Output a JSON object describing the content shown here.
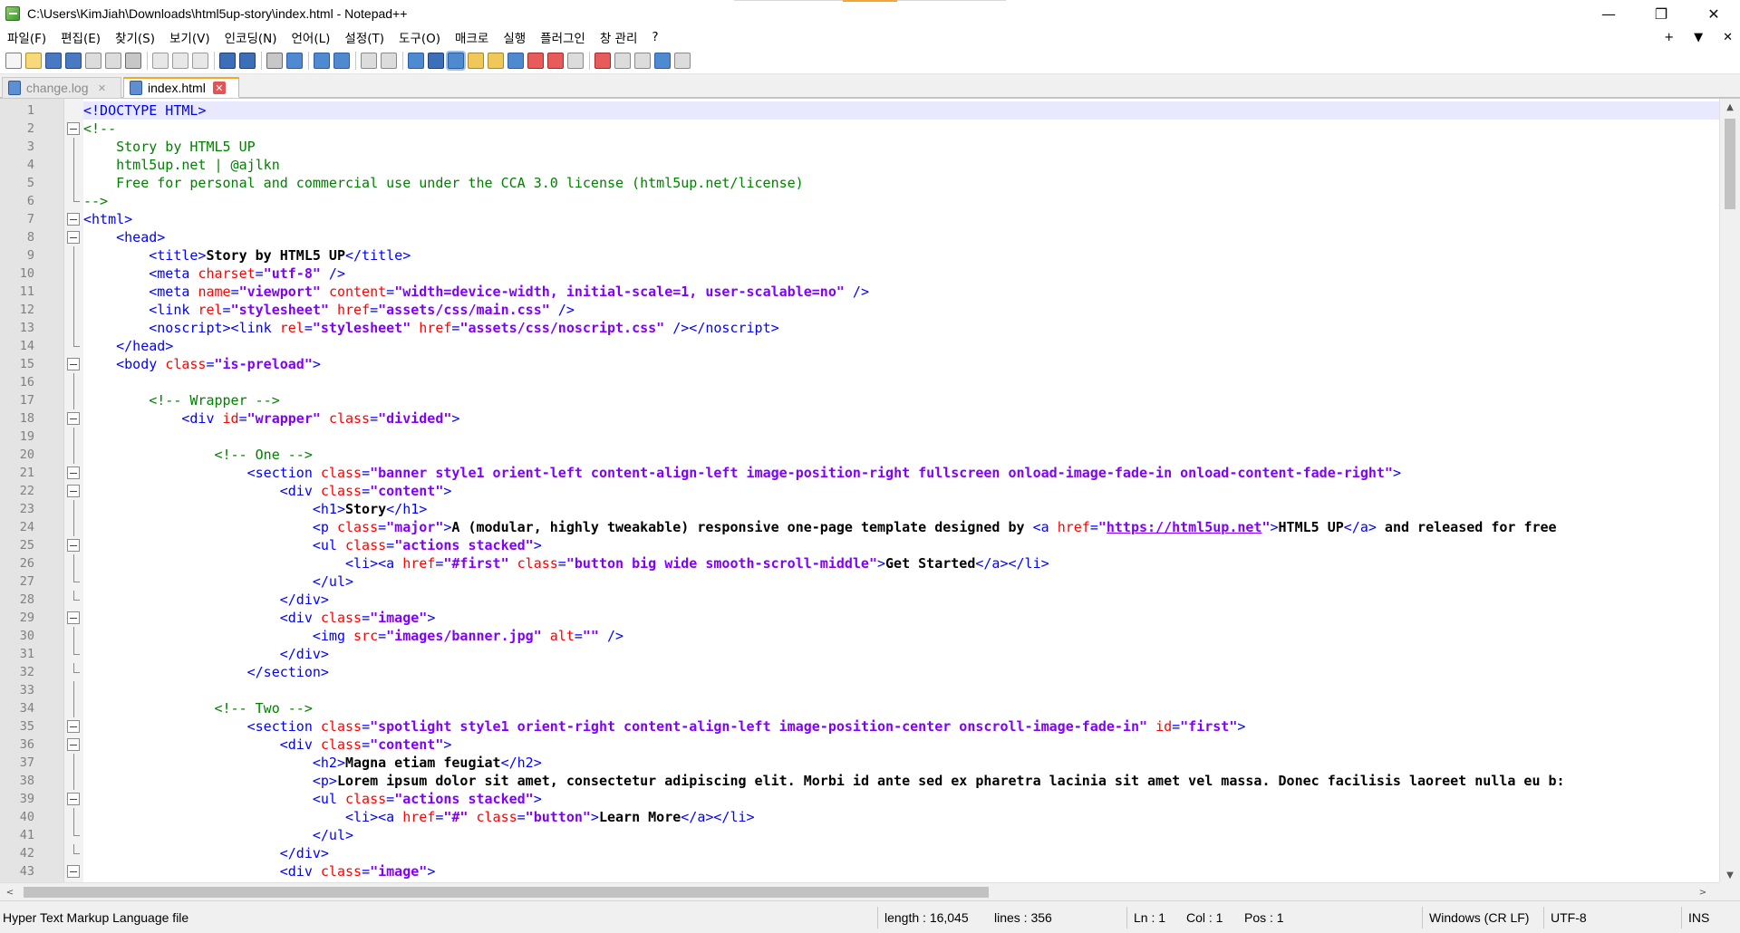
{
  "window": {
    "title": "C:\\Users\\KimJiah\\Downloads\\html5up-story\\index.html - Notepad++",
    "controls": [
      "—",
      "❐",
      "✕"
    ]
  },
  "menu": {
    "items": [
      "파일(F)",
      "편집(E)",
      "찾기(S)",
      "보기(V)",
      "인코딩(N)",
      "언어(L)",
      "설정(T)",
      "도구(O)",
      "매크로",
      "실행",
      "플러그인",
      "창 관리",
      "?"
    ],
    "right_controls": [
      "+",
      "▼",
      "✕"
    ]
  },
  "toolbar": {
    "buttons": [
      "new-file-icon",
      "open-file-icon",
      "save-icon",
      "save-all-icon",
      "close-icon",
      "close-all-icon",
      "print-icon",
      "cut-icon",
      "copy-icon",
      "paste-icon",
      "undo-icon",
      "redo-icon",
      "find-icon",
      "replace-icon",
      "zoom-in-icon",
      "zoom-out-icon",
      "sync-vertical-icon",
      "sync-horizontal-icon",
      "word-wrap-icon",
      "show-all-chars-icon",
      "indent-guide-icon",
      "udl-icon",
      "doc-map-icon",
      "function-list-icon",
      "folder-as-workspace-icon",
      "monitoring-icon",
      "record-macro-icon",
      "stop-macro-icon",
      "play-macro-icon",
      "run-macro-multiple-icon",
      "save-macro-icon"
    ],
    "active_button": "indent-guide-icon"
  },
  "tabs": [
    {
      "label": "change.log",
      "active": false
    },
    {
      "label": "index.html",
      "active": true
    }
  ],
  "editor": {
    "current_line": 1,
    "lines": [
      {
        "n": "1",
        "fold": "none",
        "tokens": [
          [
            "tag",
            "<!DOCTYPE HTML>"
          ]
        ]
      },
      {
        "n": "2",
        "fold": "box",
        "tokens": [
          [
            "com",
            "<!--"
          ]
        ]
      },
      {
        "n": "3",
        "fold": "vl",
        "tokens": [
          [
            "com",
            "\tStory by HTML5 UP"
          ]
        ]
      },
      {
        "n": "4",
        "fold": "vl",
        "tokens": [
          [
            "com",
            "\thtml5up.net | @ajlkn"
          ]
        ]
      },
      {
        "n": "5",
        "fold": "vl",
        "tokens": [
          [
            "com",
            "\tFree for personal and commercial use under the CCA 3.0 license (html5up.net/license)"
          ]
        ]
      },
      {
        "n": "6",
        "fold": "end",
        "tokens": [
          [
            "com",
            "-->"
          ]
        ]
      },
      {
        "n": "7",
        "fold": "box",
        "tokens": [
          [
            "tag",
            "<html>"
          ]
        ]
      },
      {
        "n": "8",
        "fold": "box",
        "tokens": [
          [
            "pl",
            "\t"
          ],
          [
            "tag",
            "<head>"
          ]
        ]
      },
      {
        "n": "9",
        "fold": "vl",
        "tokens": [
          [
            "pl",
            "\t\t"
          ],
          [
            "tag",
            "<title>"
          ],
          [
            "txt",
            "Story by HTML5 UP"
          ],
          [
            "tag",
            "</title>"
          ]
        ]
      },
      {
        "n": "10",
        "fold": "vl",
        "tokens": [
          [
            "pl",
            "\t\t"
          ],
          [
            "tag",
            "<meta "
          ],
          [
            "attr",
            "charset"
          ],
          [
            "tag",
            "="
          ],
          [
            "val",
            "\"utf-8\""
          ],
          [
            "tag",
            " />"
          ]
        ]
      },
      {
        "n": "11",
        "fold": "vl",
        "tokens": [
          [
            "pl",
            "\t\t"
          ],
          [
            "tag",
            "<meta "
          ],
          [
            "attr",
            "name"
          ],
          [
            "tag",
            "="
          ],
          [
            "val",
            "\"viewport\""
          ],
          [
            "tag",
            " "
          ],
          [
            "attr",
            "content"
          ],
          [
            "tag",
            "="
          ],
          [
            "val",
            "\"width=device-width, initial-scale=1, user-scalable=no\""
          ],
          [
            "tag",
            " />"
          ]
        ]
      },
      {
        "n": "12",
        "fold": "vl",
        "tokens": [
          [
            "pl",
            "\t\t"
          ],
          [
            "tag",
            "<link "
          ],
          [
            "attr",
            "rel"
          ],
          [
            "tag",
            "="
          ],
          [
            "val",
            "\"stylesheet\""
          ],
          [
            "tag",
            " "
          ],
          [
            "attr",
            "href"
          ],
          [
            "tag",
            "="
          ],
          [
            "val",
            "\"assets/css/main.css\""
          ],
          [
            "tag",
            " />"
          ]
        ]
      },
      {
        "n": "13",
        "fold": "vl",
        "tokens": [
          [
            "pl",
            "\t\t"
          ],
          [
            "tag",
            "<noscript><link "
          ],
          [
            "attr",
            "rel"
          ],
          [
            "tag",
            "="
          ],
          [
            "val",
            "\"stylesheet\""
          ],
          [
            "tag",
            " "
          ],
          [
            "attr",
            "href"
          ],
          [
            "tag",
            "="
          ],
          [
            "val",
            "\"assets/css/noscript.css\""
          ],
          [
            "tag",
            " /></noscript>"
          ]
        ]
      },
      {
        "n": "14",
        "fold": "end",
        "tokens": [
          [
            "pl",
            "\t"
          ],
          [
            "tag",
            "</head>"
          ]
        ]
      },
      {
        "n": "15",
        "fold": "box",
        "tokens": [
          [
            "pl",
            "\t"
          ],
          [
            "tag",
            "<body "
          ],
          [
            "attr",
            "class"
          ],
          [
            "tag",
            "="
          ],
          [
            "val",
            "\"is-preload\""
          ],
          [
            "tag",
            ">"
          ]
        ]
      },
      {
        "n": "16",
        "fold": "vl",
        "tokens": []
      },
      {
        "n": "17",
        "fold": "vl",
        "tokens": [
          [
            "pl",
            "\t\t"
          ],
          [
            "com",
            "<!-- Wrapper -->"
          ]
        ]
      },
      {
        "n": "18",
        "fold": "box",
        "tokens": [
          [
            "pl",
            "\t\t\t"
          ],
          [
            "tag",
            "<div "
          ],
          [
            "attr",
            "id"
          ],
          [
            "tag",
            "="
          ],
          [
            "val",
            "\"wrapper\""
          ],
          [
            "tag",
            " "
          ],
          [
            "attr",
            "class"
          ],
          [
            "tag",
            "="
          ],
          [
            "val",
            "\"divided\""
          ],
          [
            "tag",
            ">"
          ]
        ]
      },
      {
        "n": "19",
        "fold": "vl",
        "tokens": []
      },
      {
        "n": "20",
        "fold": "vl",
        "tokens": [
          [
            "pl",
            "\t\t\t\t"
          ],
          [
            "com",
            "<!-- One -->"
          ]
        ]
      },
      {
        "n": "21",
        "fold": "box",
        "tokens": [
          [
            "pl",
            "\t\t\t\t\t"
          ],
          [
            "tag",
            "<section "
          ],
          [
            "attr",
            "class"
          ],
          [
            "tag",
            "="
          ],
          [
            "val",
            "\"banner style1 orient-left content-align-left image-position-right fullscreen onload-image-fade-in onload-content-fade-right\""
          ],
          [
            "tag",
            ">"
          ]
        ]
      },
      {
        "n": "22",
        "fold": "box",
        "tokens": [
          [
            "pl",
            "\t\t\t\t\t\t"
          ],
          [
            "tag",
            "<div "
          ],
          [
            "attr",
            "class"
          ],
          [
            "tag",
            "="
          ],
          [
            "val",
            "\"content\""
          ],
          [
            "tag",
            ">"
          ]
        ]
      },
      {
        "n": "23",
        "fold": "vl",
        "tokens": [
          [
            "pl",
            "\t\t\t\t\t\t\t"
          ],
          [
            "tag",
            "<h1>"
          ],
          [
            "txt",
            "Story"
          ],
          [
            "tag",
            "</h1>"
          ]
        ]
      },
      {
        "n": "24",
        "fold": "vl",
        "tokens": [
          [
            "pl",
            "\t\t\t\t\t\t\t"
          ],
          [
            "tag",
            "<p "
          ],
          [
            "attr",
            "class"
          ],
          [
            "tag",
            "="
          ],
          [
            "val",
            "\"major\""
          ],
          [
            "tag",
            ">"
          ],
          [
            "txt",
            "A (modular, highly tweakable) responsive one-page template designed by "
          ],
          [
            "tag",
            "<a "
          ],
          [
            "attr",
            "href"
          ],
          [
            "tag",
            "="
          ],
          [
            "val",
            "\""
          ],
          [
            "link",
            "https://html5up.net"
          ],
          [
            "val",
            "\""
          ],
          [
            "tag",
            ">"
          ],
          [
            "txt",
            "HTML5 UP"
          ],
          [
            "tag",
            "</a>"
          ],
          [
            "txt",
            " and released for free"
          ]
        ]
      },
      {
        "n": "25",
        "fold": "box",
        "tokens": [
          [
            "pl",
            "\t\t\t\t\t\t\t"
          ],
          [
            "tag",
            "<ul "
          ],
          [
            "attr",
            "class"
          ],
          [
            "tag",
            "="
          ],
          [
            "val",
            "\"actions stacked\""
          ],
          [
            "tag",
            ">"
          ]
        ]
      },
      {
        "n": "26",
        "fold": "vl",
        "tokens": [
          [
            "pl",
            "\t\t\t\t\t\t\t\t"
          ],
          [
            "tag",
            "<li><a "
          ],
          [
            "attr",
            "href"
          ],
          [
            "tag",
            "="
          ],
          [
            "val",
            "\"#first\""
          ],
          [
            "tag",
            " "
          ],
          [
            "attr",
            "class"
          ],
          [
            "tag",
            "="
          ],
          [
            "val",
            "\"button big wide smooth-scroll-middle\""
          ],
          [
            "tag",
            ">"
          ],
          [
            "txt",
            "Get Started"
          ],
          [
            "tag",
            "</a></li>"
          ]
        ]
      },
      {
        "n": "27",
        "fold": "end",
        "tokens": [
          [
            "pl",
            "\t\t\t\t\t\t\t"
          ],
          [
            "tag",
            "</ul>"
          ]
        ]
      },
      {
        "n": "28",
        "fold": "end",
        "tokens": [
          [
            "pl",
            "\t\t\t\t\t\t"
          ],
          [
            "tag",
            "</div>"
          ]
        ]
      },
      {
        "n": "29",
        "fold": "box",
        "tokens": [
          [
            "pl",
            "\t\t\t\t\t\t"
          ],
          [
            "tag",
            "<div "
          ],
          [
            "attr",
            "class"
          ],
          [
            "tag",
            "="
          ],
          [
            "val",
            "\"image\""
          ],
          [
            "tag",
            ">"
          ]
        ]
      },
      {
        "n": "30",
        "fold": "vl",
        "tokens": [
          [
            "pl",
            "\t\t\t\t\t\t\t"
          ],
          [
            "tag",
            "<img "
          ],
          [
            "attr",
            "src"
          ],
          [
            "tag",
            "="
          ],
          [
            "val",
            "\"images/banner.jpg\""
          ],
          [
            "tag",
            " "
          ],
          [
            "attr",
            "alt"
          ],
          [
            "tag",
            "="
          ],
          [
            "val",
            "\"\""
          ],
          [
            "tag",
            " />"
          ]
        ]
      },
      {
        "n": "31",
        "fold": "end",
        "tokens": [
          [
            "pl",
            "\t\t\t\t\t\t"
          ],
          [
            "tag",
            "</div>"
          ]
        ]
      },
      {
        "n": "32",
        "fold": "end",
        "tokens": [
          [
            "pl",
            "\t\t\t\t\t"
          ],
          [
            "tag",
            "</section>"
          ]
        ]
      },
      {
        "n": "33",
        "fold": "vl",
        "tokens": []
      },
      {
        "n": "34",
        "fold": "vl",
        "tokens": [
          [
            "pl",
            "\t\t\t\t"
          ],
          [
            "com",
            "<!-- Two -->"
          ]
        ]
      },
      {
        "n": "35",
        "fold": "box",
        "tokens": [
          [
            "pl",
            "\t\t\t\t\t"
          ],
          [
            "tag",
            "<section "
          ],
          [
            "attr",
            "class"
          ],
          [
            "tag",
            "="
          ],
          [
            "val",
            "\"spotlight style1 orient-right content-align-left image-position-center onscroll-image-fade-in\""
          ],
          [
            "tag",
            " "
          ],
          [
            "attr",
            "id"
          ],
          [
            "tag",
            "="
          ],
          [
            "val",
            "\"first\""
          ],
          [
            "tag",
            ">"
          ]
        ]
      },
      {
        "n": "36",
        "fold": "box",
        "tokens": [
          [
            "pl",
            "\t\t\t\t\t\t"
          ],
          [
            "tag",
            "<div "
          ],
          [
            "attr",
            "class"
          ],
          [
            "tag",
            "="
          ],
          [
            "val",
            "\"content\""
          ],
          [
            "tag",
            ">"
          ]
        ]
      },
      {
        "n": "37",
        "fold": "vl",
        "tokens": [
          [
            "pl",
            "\t\t\t\t\t\t\t"
          ],
          [
            "tag",
            "<h2>"
          ],
          [
            "txt",
            "Magna etiam feugiat"
          ],
          [
            "tag",
            "</h2>"
          ]
        ]
      },
      {
        "n": "38",
        "fold": "vl",
        "tokens": [
          [
            "pl",
            "\t\t\t\t\t\t\t"
          ],
          [
            "tag",
            "<p>"
          ],
          [
            "txt",
            "Lorem ipsum dolor sit amet, consectetur adipiscing elit. Morbi id ante sed ex pharetra lacinia sit amet vel massa. Donec facilisis laoreet nulla eu b:"
          ]
        ]
      },
      {
        "n": "39",
        "fold": "box",
        "tokens": [
          [
            "pl",
            "\t\t\t\t\t\t\t"
          ],
          [
            "tag",
            "<ul "
          ],
          [
            "attr",
            "class"
          ],
          [
            "tag",
            "="
          ],
          [
            "val",
            "\"actions stacked\""
          ],
          [
            "tag",
            ">"
          ]
        ]
      },
      {
        "n": "40",
        "fold": "vl",
        "tokens": [
          [
            "pl",
            "\t\t\t\t\t\t\t\t"
          ],
          [
            "tag",
            "<li><a "
          ],
          [
            "attr",
            "href"
          ],
          [
            "tag",
            "="
          ],
          [
            "val",
            "\"#\""
          ],
          [
            "tag",
            " "
          ],
          [
            "attr",
            "class"
          ],
          [
            "tag",
            "="
          ],
          [
            "val",
            "\"button\""
          ],
          [
            "tag",
            ">"
          ],
          [
            "txt",
            "Learn More"
          ],
          [
            "tag",
            "</a></li>"
          ]
        ]
      },
      {
        "n": "41",
        "fold": "end",
        "tokens": [
          [
            "pl",
            "\t\t\t\t\t\t\t"
          ],
          [
            "tag",
            "</ul>"
          ]
        ]
      },
      {
        "n": "42",
        "fold": "end",
        "tokens": [
          [
            "pl",
            "\t\t\t\t\t\t"
          ],
          [
            "tag",
            "</div>"
          ]
        ]
      },
      {
        "n": "43",
        "fold": "box",
        "tokens": [
          [
            "pl",
            "\t\t\t\t\t\t"
          ],
          [
            "tag",
            "<div "
          ],
          [
            "attr",
            "class"
          ],
          [
            "tag",
            "="
          ],
          [
            "val",
            "\"image\""
          ],
          [
            "tag",
            ">"
          ]
        ]
      }
    ]
  },
  "scrollbars": {
    "left_arrow": "<",
    "right_arrow": ">",
    "up_arrow": "▲",
    "down_arrow": "▼"
  },
  "statusbar": {
    "file_type": "Hyper Text Markup Language file",
    "length": "length : 16,045",
    "lines": "lines : 356",
    "ln": "Ln : 1",
    "col": "Col : 1",
    "pos": "Pos : 1",
    "eol": "Windows (CR LF)",
    "encoding": "UTF-8",
    "mode": "INS"
  },
  "colors": {
    "tag": "#0000ff",
    "attribute": "#ff0000",
    "value": "#8000ff",
    "comment": "#008000",
    "current_line": "#e8e8ff",
    "active_tab_accent": "#f5a623"
  }
}
